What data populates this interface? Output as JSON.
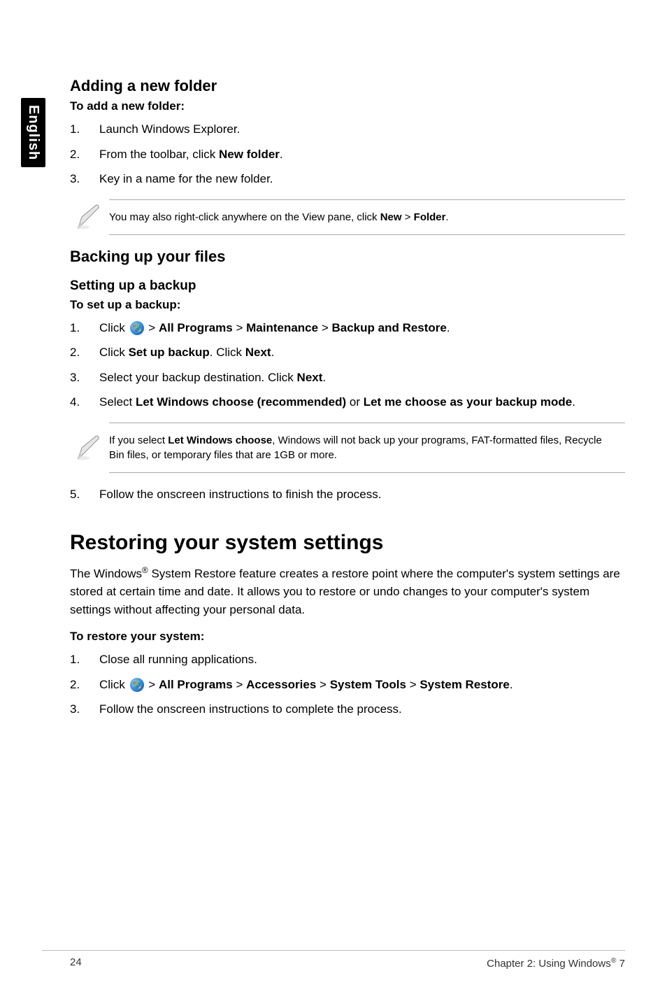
{
  "sideTab": "English",
  "addFolder": {
    "heading": "Adding a new folder",
    "lead": "To add a new folder:",
    "steps": [
      {
        "num": "1.",
        "text": "Launch Windows Explorer."
      },
      {
        "num": "2.",
        "pre": "From the toolbar, click ",
        "bold": "New folder",
        "post": "."
      },
      {
        "num": "3.",
        "text": "Key in a name for the new folder."
      }
    ],
    "note": {
      "pre": "You may also right-click anywhere on the View pane, click ",
      "b1": "New",
      "mid": " > ",
      "b2": "Folder",
      "post": "."
    }
  },
  "backup": {
    "heading": "Backing up your files",
    "subheading": "Setting up a backup",
    "lead": "To set up a backup:",
    "step1": {
      "num": "1.",
      "pre": "Click ",
      "gt1": " > ",
      "b1": "All Programs",
      "gt2": " > ",
      "b2": "Maintenance",
      "gt3": " > ",
      "b3": "Backup and Restore",
      "post": "."
    },
    "step2": {
      "num": "2.",
      "pre": "Click ",
      "b1": "Set up backup",
      "mid": ". Click ",
      "b2": "Next",
      "post": "."
    },
    "step3": {
      "num": "3.",
      "pre": "Select your backup destination. Click ",
      "b1": "Next",
      "post": "."
    },
    "step4": {
      "num": "4.",
      "pre": "Select ",
      "b1": "Let Windows choose (recommended)",
      "mid": " or ",
      "b2": "Let me choose as your backup mode",
      "post": "."
    },
    "note": {
      "pre": "If you select ",
      "b1": "Let Windows choose",
      "post": ", Windows will not back up your programs, FAT-formatted files, Recycle Bin files, or temporary files that are 1GB or more."
    },
    "step5": {
      "num": "5.",
      "text": "Follow the onscreen instructions to finish the process."
    }
  },
  "restore": {
    "heading": "Restoring your system settings",
    "para": {
      "pre": "The Windows",
      "sup": "®",
      "post": " System Restore feature creates a restore point where the computer's system settings are stored at certain time and date. It allows you to restore or undo changes to your computer's system settings without affecting your personal data."
    },
    "lead": "To restore your system:",
    "step1": {
      "num": "1.",
      "text": "Close all running applications."
    },
    "step2": {
      "num": "2.",
      "pre": "Click ",
      "gt1": " > ",
      "b1": "All Programs",
      "gt2": " > ",
      "b2": "Accessories",
      "gt3": " > ",
      "b3": "System Tools",
      "gt4": " > ",
      "b4": "System Restore",
      "post": "."
    },
    "step3": {
      "num": "3.",
      "text": "Follow the onscreen instructions to complete the process."
    }
  },
  "footer": {
    "pageNum": "24",
    "chapterPre": "Chapter 2: Using Windows",
    "chapterSup": "®",
    "chapterPost": " 7"
  }
}
